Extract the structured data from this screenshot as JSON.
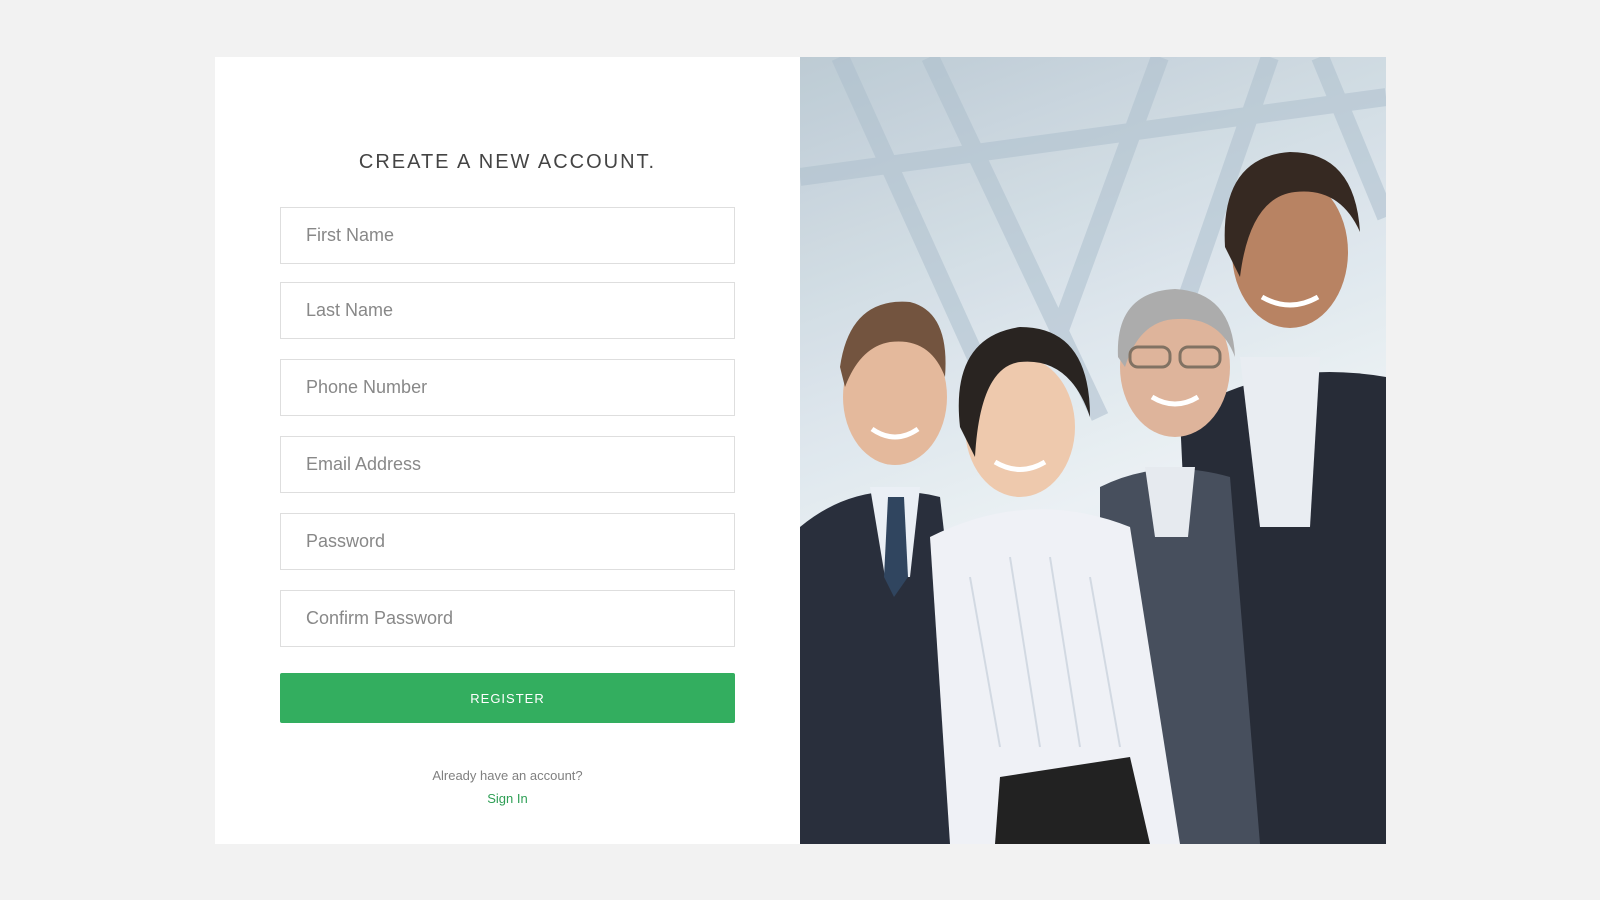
{
  "form": {
    "title": "CREATE A NEW ACCOUNT.",
    "fields": {
      "first_name": {
        "placeholder": "First Name",
        "value": ""
      },
      "last_name": {
        "placeholder": "Last Name",
        "value": ""
      },
      "phone": {
        "placeholder": "Phone Number",
        "value": ""
      },
      "email": {
        "placeholder": "Email Address",
        "value": ""
      },
      "password": {
        "placeholder": "Password",
        "value": ""
      },
      "confirm_password": {
        "placeholder": "Confirm Password",
        "value": ""
      }
    },
    "register_label": "REGISTER",
    "already_text": "Already have an account?",
    "signin_label": "Sign In"
  },
  "colors": {
    "accent": "#33ae5f",
    "link": "#2e9f55",
    "page_background": "#f2f2f2",
    "card_background": "#ffffff",
    "border": "#dedede"
  },
  "image": {
    "icon": "team-photo-icon"
  }
}
